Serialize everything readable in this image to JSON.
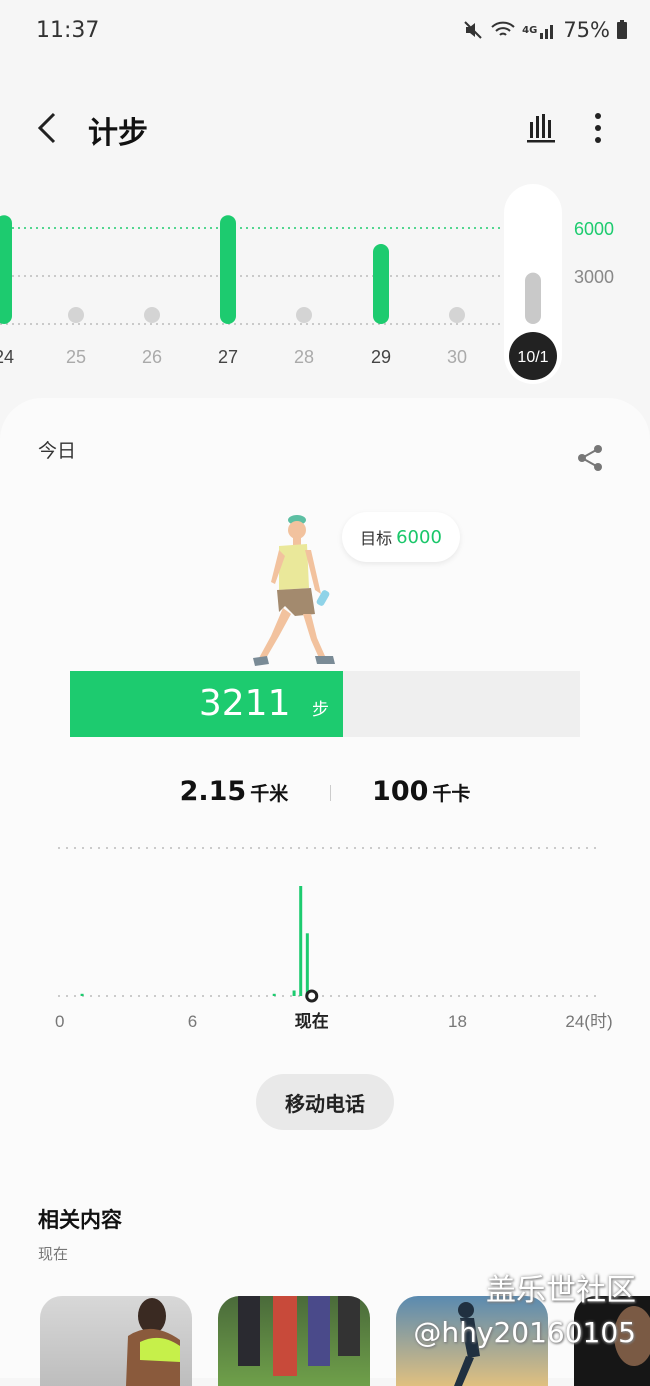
{
  "status_bar": {
    "time": "11:37",
    "battery": "75%",
    "network": "4G"
  },
  "app_bar": {
    "title": "计步"
  },
  "week_chart": {
    "goal_label": "6000",
    "ref_label": "3000",
    "days": [
      {
        "label": "24",
        "steps": 6800
      },
      {
        "label": "25",
        "steps": 0
      },
      {
        "label": "26",
        "steps": 0
      },
      {
        "label": "27",
        "steps": 6800
      },
      {
        "label": "28",
        "steps": 0
      },
      {
        "label": "29",
        "steps": 5000
      },
      {
        "label": "30",
        "steps": 0
      },
      {
        "label": "10/1",
        "steps": 3211,
        "selected": true
      }
    ]
  },
  "today": {
    "label": "今日",
    "goal_prefix": "目标",
    "goal_value": "6000",
    "goal_steps": 6000,
    "steps": "3211",
    "steps_value": 3211,
    "steps_unit": "步",
    "distance": "2.15",
    "distance_unit": "千米",
    "calories": "100",
    "calories_unit": "千卡"
  },
  "day_chart": {
    "x_labels": [
      "0",
      "6",
      "现在",
      "18",
      "24(时)"
    ],
    "now_hour": 11.4,
    "bars": [
      {
        "hour": 1.0,
        "value": 2
      },
      {
        "hour": 9.7,
        "value": 2
      },
      {
        "hour": 10.6,
        "value": 5
      },
      {
        "hour": 10.9,
        "value": 100
      },
      {
        "hour": 11.2,
        "value": 57
      }
    ]
  },
  "device_button": {
    "label": "移动电话"
  },
  "related": {
    "title": "相关内容",
    "subtitle": "现在"
  },
  "watermark": {
    "line1": "盖乐世社区",
    "line2": "@hhy20160105"
  },
  "colors": {
    "accent": "#1dcb6f",
    "goal_text": "#1ac76a",
    "background": "#f6f6f6"
  }
}
